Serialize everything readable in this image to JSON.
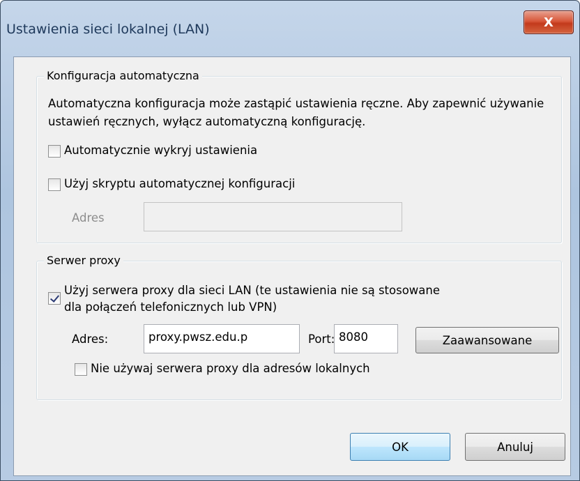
{
  "window": {
    "title": "Ustawienia sieci lokalnej (LAN)",
    "close_glyph": "X"
  },
  "auto_config": {
    "group_title": "Konfiguracja automatyczna",
    "description": "Automatyczna konfiguracja może zastąpić ustawienia ręczne. Aby zapewnić używanie ustawień ręcznych, wyłącz automatyczną konfigurację.",
    "auto_detect_label": "Automatycznie wykryj ustawienia",
    "auto_detect_checked": false,
    "use_script_label": "Użyj skryptu automatycznej konfiguracji",
    "use_script_checked": false,
    "address_label": "Adres",
    "address_value": ""
  },
  "proxy": {
    "group_title": "Serwer proxy",
    "use_proxy_label_line1": "Użyj serwera proxy dla sieci LAN (te ustawienia nie są stosowane",
    "use_proxy_label_line2": "dla połączeń telefonicznych lub VPN)",
    "use_proxy_checked": true,
    "address_label": "Adres:",
    "address_value": "proxy.pwsz.edu.p",
    "port_label": "Port:",
    "port_value": "8080",
    "advanced_button": "Zaawansowane",
    "bypass_local_label": "Nie używaj serwera proxy dla adresów lokalnych",
    "bypass_local_checked": false
  },
  "buttons": {
    "ok": "OK",
    "cancel": "Anuluj"
  }
}
